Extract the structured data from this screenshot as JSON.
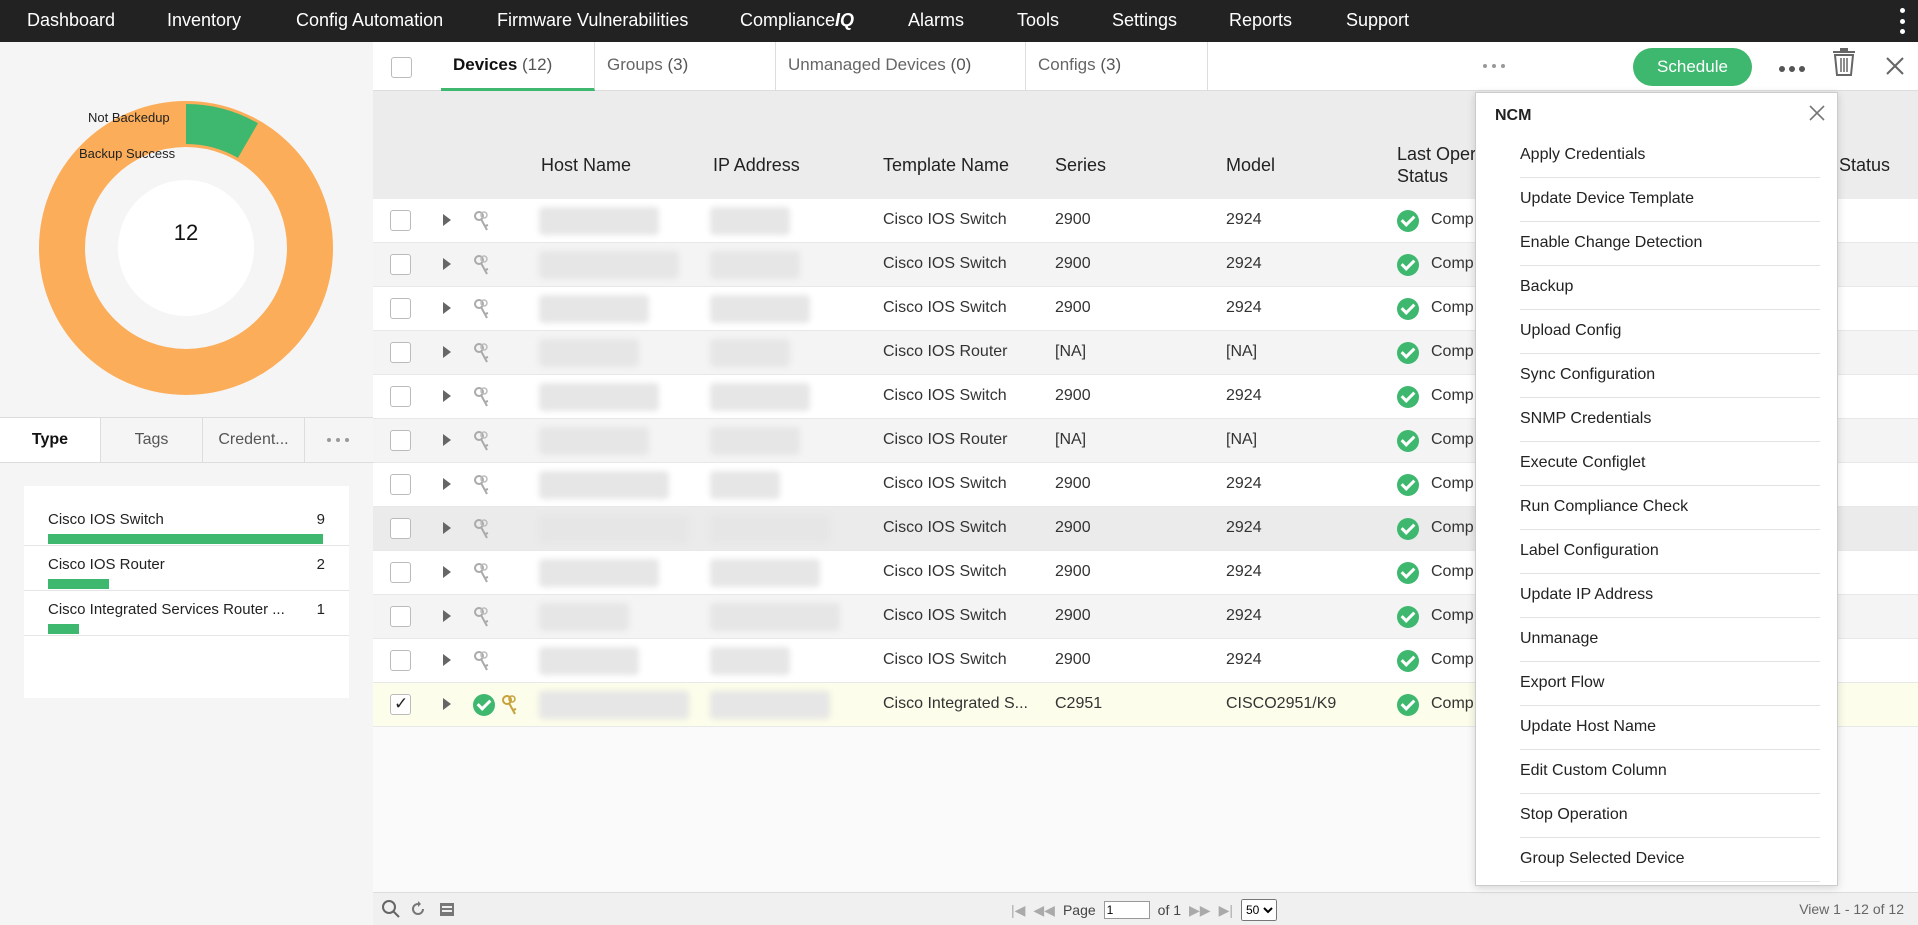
{
  "topnav": {
    "items": [
      "Dashboard",
      "Inventory",
      "Config Automation",
      "Firmware Vulnerabilities",
      "Compliance",
      "Alarms",
      "Tools",
      "Settings",
      "Reports",
      "Support"
    ],
    "compliance_suffix": "IQ"
  },
  "donut": {
    "center_value": "12",
    "legend": [
      "Not Backedup",
      "Backup Success"
    ],
    "colors": {
      "not_backedup": "#fbad5a",
      "backup_success": "#3fb86f"
    },
    "fractions": {
      "not_backedup": 0.9167,
      "backup_success": 0.0833
    }
  },
  "left_tabs": [
    "Type",
    "Tags",
    "Credent..."
  ],
  "type_list": [
    {
      "name": "Cisco IOS Switch",
      "count": "9",
      "fraction": 1.0
    },
    {
      "name": "Cisco IOS Router",
      "count": "2",
      "fraction": 0.222
    },
    {
      "name": "Cisco Integrated Services Router ...",
      "count": "1",
      "fraction": 0.111
    }
  ],
  "tabs": [
    {
      "label": "Devices",
      "count": "(12)"
    },
    {
      "label": "Groups",
      "count": "(3)"
    },
    {
      "label": "Unmanaged Devices",
      "count": "(0)"
    },
    {
      "label": "Configs",
      "count": "(3)"
    }
  ],
  "schedule_label": "Schedule",
  "table": {
    "headers": [
      "Host Name",
      "IP Address",
      "Template Name",
      "Series",
      "Model",
      "Last Opera",
      "Status"
    ],
    "header_status_line2": "Status",
    "rows": [
      {
        "template": "Cisco IOS Switch",
        "series": "2900",
        "model": "2924",
        "status": "Comp"
      },
      {
        "template": "Cisco IOS Switch",
        "series": "2900",
        "model": "2924",
        "status": "Comp"
      },
      {
        "template": "Cisco IOS Switch",
        "series": "2900",
        "model": "2924",
        "status": "Comp"
      },
      {
        "template": "Cisco IOS Router",
        "series": "[NA]",
        "model": "[NA]",
        "status": "Comp"
      },
      {
        "template": "Cisco IOS Switch",
        "series": "2900",
        "model": "2924",
        "status": "Comp"
      },
      {
        "template": "Cisco IOS Router",
        "series": "[NA]",
        "model": "[NA]",
        "status": "Comp"
      },
      {
        "template": "Cisco IOS Switch",
        "series": "2900",
        "model": "2924",
        "status": "Comp"
      },
      {
        "template": "Cisco IOS Switch",
        "series": "2900",
        "model": "2924",
        "status": "Comp"
      },
      {
        "template": "Cisco IOS Switch",
        "series": "2900",
        "model": "2924",
        "status": "Comp"
      },
      {
        "template": "Cisco IOS Switch",
        "series": "2900",
        "model": "2924",
        "status": "Comp"
      },
      {
        "template": "Cisco IOS Switch",
        "series": "2900",
        "model": "2924",
        "status": "Comp"
      },
      {
        "template": "Cisco Integrated S...",
        "series": "C2951",
        "model": "CISCO2951/K9",
        "status": "Comp",
        "selected": true
      }
    ]
  },
  "footer": {
    "page_label": "Page",
    "page_value": "1",
    "of_label": "of 1",
    "per_page": "50",
    "view_text": "View 1 - 12 of 12"
  },
  "ncm_menu": {
    "title": "NCM",
    "items": [
      "Apply Credentials",
      "Update Device Template",
      "Enable Change Detection",
      "Backup",
      "Upload Config",
      "Sync Configuration",
      "SNMP Credentials",
      "Execute Configlet",
      "Run Compliance Check",
      "Label Configuration",
      "Update IP Address",
      "Unmanage",
      "Export Flow",
      "Update Host Name",
      "Edit Custom Column",
      "Stop Operation",
      "Group Selected Device"
    ]
  }
}
